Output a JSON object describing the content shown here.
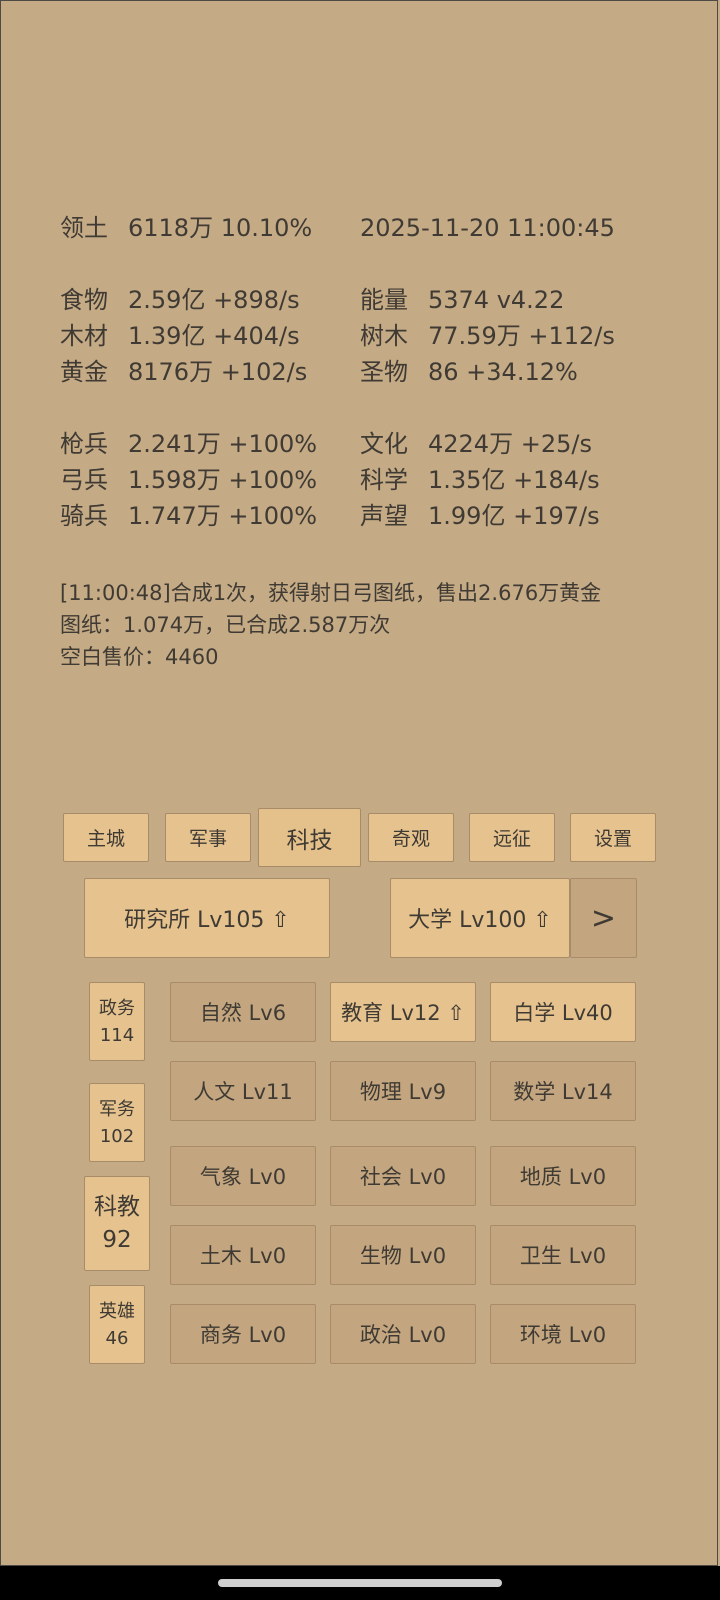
{
  "stats": {
    "territory": {
      "label": "领土",
      "value": "6118万  10.10%"
    },
    "datetime": "2025-11-20 11:00:45",
    "resources": [
      {
        "label": "食物",
        "value": "2.59亿 +898/s",
        "rlabel": "能量",
        "rvalue": "5374  v4.22"
      },
      {
        "label": "木材",
        "value": "1.39亿 +404/s",
        "rlabel": "树木",
        "rvalue": "77.59万 +112/s"
      },
      {
        "label": "黄金",
        "value": "8176万 +102/s",
        "rlabel": "圣物",
        "rvalue": "86 +34.12%"
      }
    ],
    "military": [
      {
        "label": "枪兵",
        "value": "2.241万 +100%",
        "rlabel": "文化",
        "rvalue": "4224万 +25/s"
      },
      {
        "label": "弓兵",
        "value": "1.598万 +100%",
        "rlabel": "科学",
        "rvalue": "1.35亿 +184/s"
      },
      {
        "label": "骑兵",
        "value": "1.747万 +100%",
        "rlabel": "声望",
        "rvalue": "1.99亿 +197/s"
      }
    ]
  },
  "log": [
    "[11:00:48]合成1次，获得射日弓图纸，售出2.676万黄金",
    "图纸：1.074万，已合成2.587万次",
    "空白售价：4460"
  ],
  "tabs": [
    "主城",
    "军事",
    "科技",
    "奇观",
    "远征",
    "设置"
  ],
  "buildings": {
    "research": "研究所 Lv105 ⇧",
    "university": "大学 Lv100 ⇧",
    "next": ">"
  },
  "side": [
    {
      "name": "政务",
      "value": "114"
    },
    {
      "name": "军务",
      "value": "102"
    },
    {
      "name": "科教",
      "value": "92"
    },
    {
      "name": "英雄",
      "value": "46"
    }
  ],
  "techs": [
    "自然 Lv6",
    "教育 Lv12 ⇧",
    "白学 Lv40",
    "人文 Lv11",
    "物理 Lv9",
    "数学 Lv14",
    "气象 Lv0",
    "社会 Lv0",
    "地质 Lv0",
    "土木 Lv0",
    "生物 Lv0",
    "卫生 Lv0",
    "商务 Lv0",
    "政治 Lv0",
    "环境 Lv0"
  ]
}
